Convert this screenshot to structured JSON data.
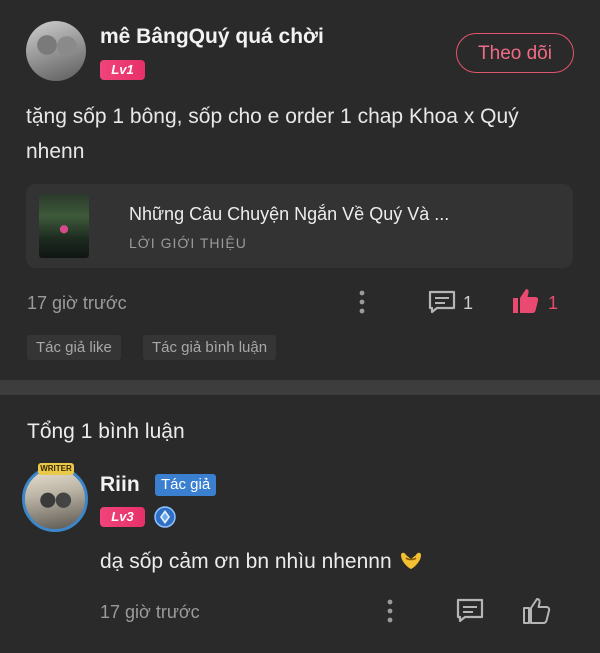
{
  "post": {
    "username": "mê BângQuý quá chời",
    "level": "Lv1",
    "follow_label": "Theo dõi",
    "text": "tặng sốp 1 bông, sốp cho e order 1 chap Khoa x Quý nhenn",
    "book": {
      "title": "Những Câu Chuyện Ngắn Về Quý Và ...",
      "subtitle": "LỜI GIỚI THIỆU"
    },
    "time": "17 giờ trước",
    "comment_count": "1",
    "like_count": "1",
    "tags": [
      "Tác giả like",
      "Tác giả bình luận"
    ]
  },
  "comments_section": {
    "title": "Tổng 1 bình luận"
  },
  "comment": {
    "username": "Riin",
    "author_tag": "Tác giả",
    "level": "Lv3",
    "crest_text": "WRITER",
    "text": "dạ sốp cảm ơn bn nhìu nhennn",
    "time": "17 giờ trước"
  },
  "colors": {
    "background": "#2a2a2a",
    "accent_pink": "#ea4a72",
    "author_blue": "#3a7fd0"
  },
  "icons": [
    "more-vertical-icon",
    "comment-icon",
    "thumbs-up-icon",
    "rank-diamond-icon",
    "hug-emoji-icon"
  ]
}
